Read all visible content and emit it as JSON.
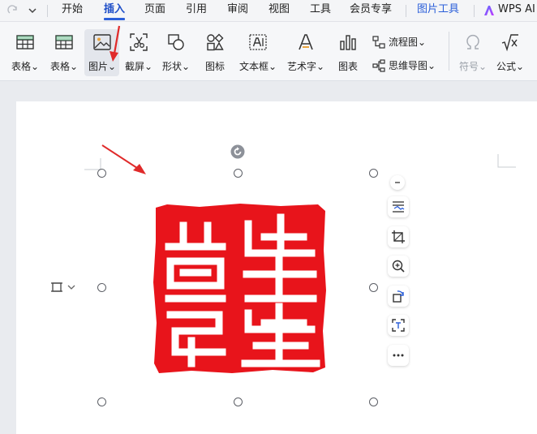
{
  "menubar": {
    "items": [
      "开始",
      "插入",
      "页面",
      "引用",
      "审阅",
      "视图",
      "工具",
      "会员专享"
    ],
    "active_item": "插入",
    "picture_tools": "图片工具",
    "wps_ai": "WPS AI"
  },
  "ribbon": {
    "buttons": [
      {
        "label": "表格",
        "icon": "table-icon",
        "dropdown": true
      },
      {
        "label": "表格",
        "icon": "table-grid-icon",
        "dropdown": true
      },
      {
        "label": "图片",
        "icon": "picture-icon",
        "dropdown": true,
        "highlighted": true
      },
      {
        "label": "截屏",
        "icon": "screenshot-icon",
        "dropdown": true
      },
      {
        "label": "形状",
        "icon": "shapes-icon",
        "dropdown": true
      },
      {
        "label": "图标",
        "icon": "icons-icon",
        "dropdown": false
      },
      {
        "label": "文本框",
        "icon": "textbox-icon",
        "dropdown": true
      },
      {
        "label": "艺术字",
        "icon": "wordart-icon",
        "dropdown": true
      },
      {
        "label": "图表",
        "icon": "chart-icon",
        "dropdown": false
      }
    ],
    "flowchart": "流程图",
    "mindmap": "思维导图",
    "symbol": "符号",
    "formula": "公式",
    "dropdown_glyph": "⌄"
  },
  "side_toolbar": [
    "wrap-text-icon",
    "crop-icon",
    "zoom-icon",
    "rotate-icon",
    "extract-text-icon",
    "more-icon"
  ],
  "colors": {
    "accent": "#2b5fd9",
    "seal_red": "#e8141b",
    "arrow_red": "#e02a2a"
  }
}
